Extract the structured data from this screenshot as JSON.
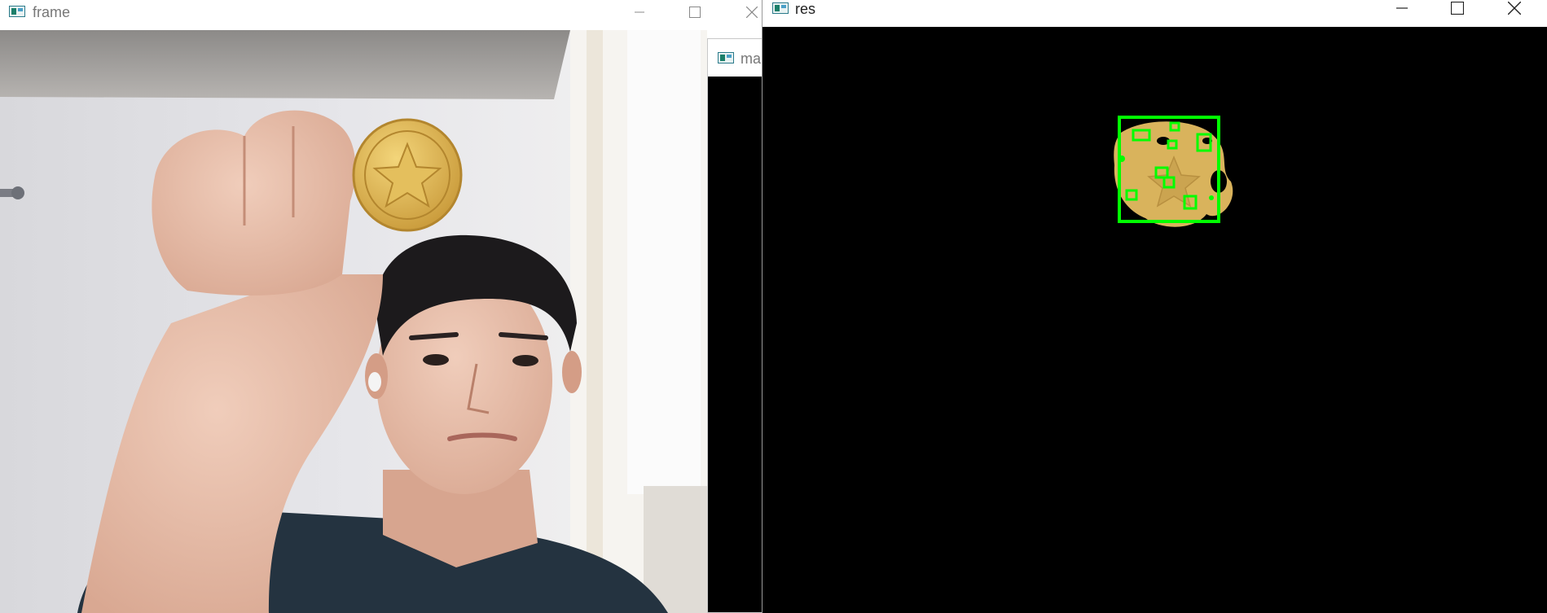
{
  "windows": {
    "frame": {
      "title": "frame"
    },
    "mask": {
      "title": "ma"
    },
    "res": {
      "title": "res"
    }
  },
  "colors": {
    "detection_box": "#00ff00",
    "coin": "#d9b35c",
    "background": "#000000"
  },
  "icons": [
    "app-window-icon",
    "minimize-icon",
    "maximize-icon",
    "close-icon"
  ]
}
